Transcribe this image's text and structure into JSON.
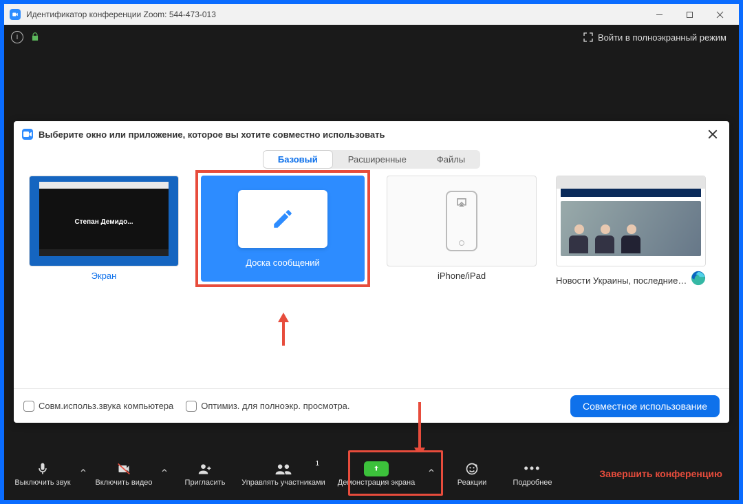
{
  "window": {
    "title": "Идентификатор конференции Zoom: 544-473-013"
  },
  "top": {
    "fullscreen_label": "Войти в полноэкранный режим"
  },
  "share": {
    "title": "Выберите окно или приложение, которое вы хотите совместно использовать",
    "tabs": {
      "basic": "Базовый",
      "advanced": "Расширенные",
      "files": "Файлы"
    },
    "items": {
      "screen": {
        "caption": "Экран",
        "mini_text": "Степан  Демидо..."
      },
      "whiteboard": {
        "caption": "Доска сообщений"
      },
      "iphone": {
        "caption": "iPhone/iPad"
      },
      "news": {
        "caption": "Новости Украины, последние н..."
      }
    },
    "footer": {
      "share_audio": "Совм.использ.звука компьютера",
      "optimize": "Оптимиз. для полноэкр. просмотра.",
      "cta": "Совместное использование"
    }
  },
  "toolbar": {
    "mute": "Выключить звук",
    "video": "Включить видео",
    "invite": "Пригласить",
    "participants": "Управлять участниками",
    "participants_count": "1",
    "share": "Демонстрация экрана",
    "reactions": "Реакции",
    "more": "Подробнее",
    "end": "Завершить конференцию"
  }
}
